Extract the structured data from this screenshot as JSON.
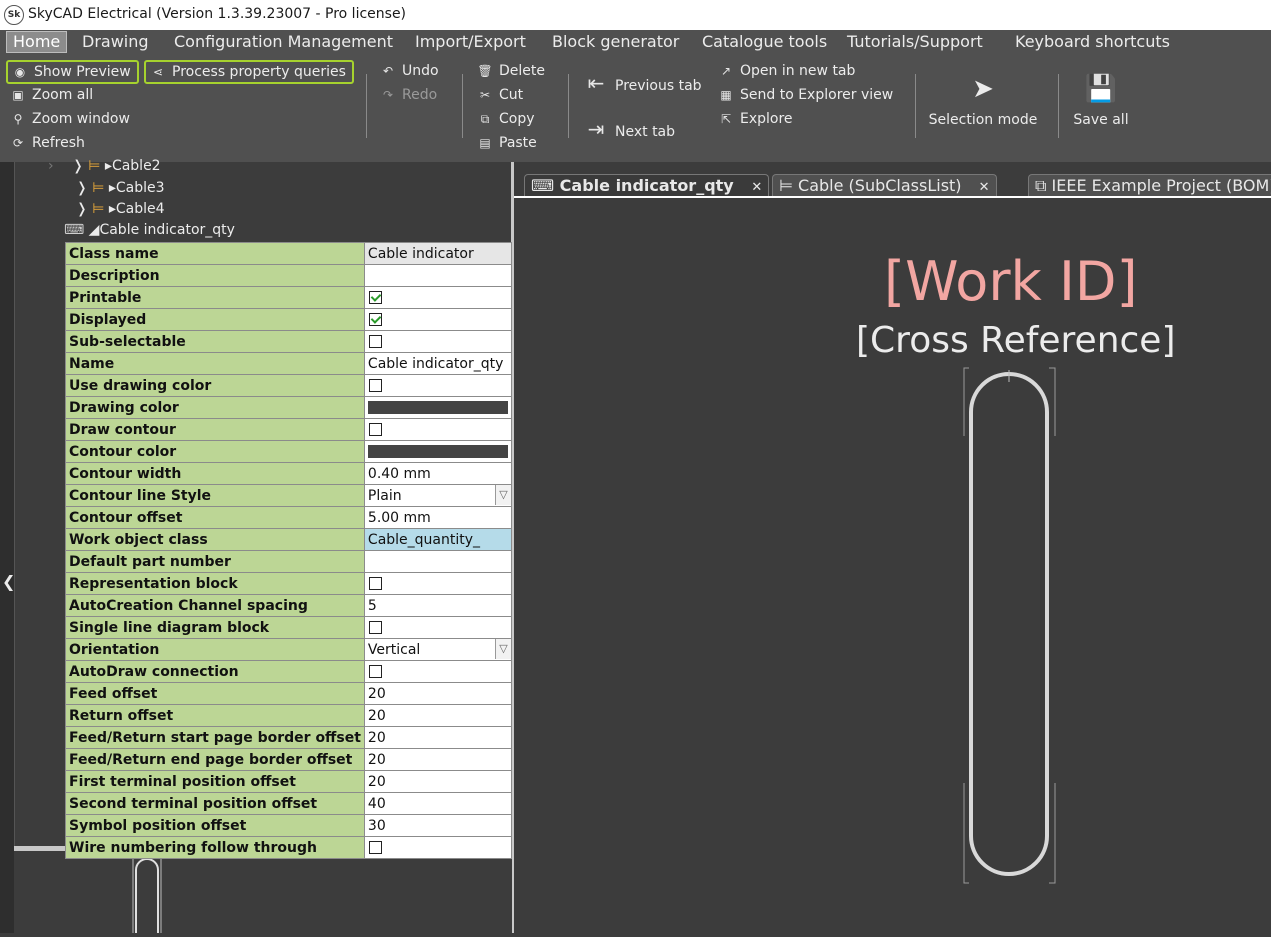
{
  "window": {
    "title": "SkyCAD Electrical (Version 1.3.39.23007 - Pro license)",
    "logo_text": "Sk"
  },
  "menu": [
    "Home",
    "Drawing",
    "Configuration Management",
    "Import/Export",
    "Block generator",
    "Catalogue tools",
    "Tutorials/Support",
    "Keyboard shortcuts"
  ],
  "ribbon": {
    "show_preview": "Show Preview",
    "process_queries": "Process property queries",
    "zoom_all": "Zoom all",
    "zoom_window": "Zoom window",
    "refresh": "Refresh",
    "undo": "Undo",
    "redo": "Redo",
    "delete": "Delete",
    "cut": "Cut",
    "copy": "Copy",
    "paste": "Paste",
    "previous_tab": "Previous tab",
    "next_tab": "Next tab",
    "open_new_tab": "Open in new tab",
    "send_explorer": "Send to Explorer view",
    "explore": "Explore",
    "selection_mode": "Selection mode",
    "save_all": "Save all"
  },
  "tree": {
    "items": [
      "Cable2",
      "Cable3",
      "Cable4"
    ],
    "selected": "Cable indicator_qty"
  },
  "properties": {
    "header": {
      "name": "Class name",
      "value": "Cable indicator"
    },
    "rows": [
      {
        "name": "Description",
        "type": "text",
        "value": ""
      },
      {
        "name": "Printable",
        "type": "checkbox",
        "checked": true
      },
      {
        "name": "Displayed",
        "type": "checkbox",
        "checked": true
      },
      {
        "name": "Sub-selectable",
        "type": "checkbox",
        "checked": false
      },
      {
        "name": "Name",
        "type": "text",
        "value": "Cable indicator_qty"
      },
      {
        "name": "Use drawing color",
        "type": "checkbox",
        "checked": false
      },
      {
        "name": "Drawing color",
        "type": "color",
        "color": "#444444"
      },
      {
        "name": "Draw contour",
        "type": "checkbox",
        "checked": false
      },
      {
        "name": "Contour color",
        "type": "color",
        "color": "#444444"
      },
      {
        "name": "Contour width",
        "type": "text",
        "value": "0.40 mm"
      },
      {
        "name": "Contour line Style",
        "type": "dropdown",
        "value": "Plain"
      },
      {
        "name": "Contour offset",
        "type": "text",
        "value": "5.00 mm"
      },
      {
        "name": "Work object class",
        "type": "highlight",
        "value": "Cable_quantity_"
      },
      {
        "name": "Default part number",
        "type": "text",
        "value": ""
      },
      {
        "name": "Representation block",
        "type": "checkbox",
        "checked": false
      },
      {
        "name": "AutoCreation Channel spacing",
        "type": "text",
        "value": "5"
      },
      {
        "name": "Single line diagram block",
        "type": "checkbox",
        "checked": false
      },
      {
        "name": "Orientation",
        "type": "dropdown",
        "value": "Vertical"
      },
      {
        "name": "AutoDraw connection",
        "type": "checkbox",
        "checked": false
      },
      {
        "name": "Feed offset",
        "type": "text",
        "value": "20"
      },
      {
        "name": "Return offset",
        "type": "text",
        "value": "20"
      },
      {
        "name": "Feed/Return start page border offset",
        "type": "text",
        "value": "20"
      },
      {
        "name": "Feed/Return end page border offset",
        "type": "text",
        "value": "20"
      },
      {
        "name": "First terminal position offset",
        "type": "text",
        "value": "20"
      },
      {
        "name": "Second terminal position offset",
        "type": "text",
        "value": "40"
      },
      {
        "name": "Symbol position offset",
        "type": "text",
        "value": "30"
      },
      {
        "name": "Wire numbering follow through",
        "type": "checkbox",
        "checked": false
      }
    ]
  },
  "tabs": [
    {
      "label": "Cable indicator_qty",
      "active": true,
      "icon": "symbol-icon",
      "closable": true
    },
    {
      "label": "Cable (SubClassList)",
      "active": false,
      "icon": "cable-icon",
      "closable": true
    },
    {
      "label": "IEEE Example Project (BOM)",
      "active": false,
      "icon": "document-icon",
      "closable": false
    }
  ],
  "canvas": {
    "work_id": "[Work ID]",
    "cross_reference": "[Cross Reference]"
  },
  "colors": {
    "accent_highlight": "#a6d22e",
    "property_name_bg": "#bcd695",
    "work_id_text": "#f2a6a2",
    "selected_value_bg": "#b5dbe9"
  }
}
